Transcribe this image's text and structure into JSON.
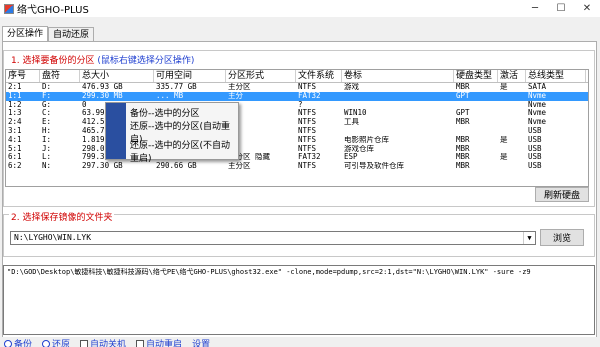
{
  "window": {
    "title": "络弋GHO-PLUS",
    "min": "─",
    "max": "☐",
    "close": "✕"
  },
  "tabs": [
    {
      "label": "分区操作",
      "active": true
    },
    {
      "label": "自动还原",
      "active": false
    }
  ],
  "section1": {
    "prefix": "1.",
    "text": "选择要备份的分区",
    "hint": "(鼠标右键选择分区操作)"
  },
  "columns": [
    "序号",
    "盘符",
    "总大小",
    "可用空间",
    "分区形式",
    "文件系统",
    "卷标",
    "硬盘类型",
    "激活",
    "总线类型"
  ],
  "rows": [
    [
      "2:1",
      "D:",
      "476.93  GB",
      "335.77  GB",
      "主分区",
      "NTFS",
      "游戏",
      "MBR",
      "是",
      "SATA"
    ],
    [
      "1:1",
      "F:",
      "299.30  MB",
      "...  MB",
      "主分",
      "FAT32",
      "",
      "GPT",
      "",
      "Nvme"
    ],
    [
      "1:2",
      "G:",
      "0",
      "",
      "",
      "?",
      "",
      "",
      "",
      "Nvme"
    ],
    [
      "1:3",
      "C:",
      "63.99",
      "",
      "",
      "NTFS",
      "WIN10",
      "GPT",
      "",
      "Nvme"
    ],
    [
      "2:4",
      "E:",
      "412.5",
      "",
      "",
      "NTFS",
      "工具",
      "MBR",
      "",
      "Nvme"
    ],
    [
      "3:1",
      "H:",
      "465.7",
      "",
      "",
      "NTFS",
      "",
      "",
      "",
      "USB"
    ],
    [
      "4:1",
      "I:",
      "1.819",
      "",
      "",
      "NTFS",
      "电影照片仓库",
      "MBR",
      "是",
      "USB"
    ],
    [
      "5:1",
      "J:",
      "298.0",
      "",
      "",
      "NTFS",
      "游戏仓库",
      "MBR",
      "",
      "USB"
    ],
    [
      "6:1",
      "L:",
      "799.39  MB",
      "325.84  MB",
      "主分区 隐藏",
      "FAT32",
      "ESP",
      "MBR",
      "是",
      "USB"
    ],
    [
      "6:2",
      "N:",
      "297.30  GB",
      "290.66  GB",
      "主分区",
      "NTFS",
      "可引导及软件仓库",
      "MBR",
      "",
      "USB"
    ]
  ],
  "selected_row": 1,
  "refresh_label": "刷新硬盘",
  "section2": {
    "prefix": "2.",
    "text": "选择保存镜像的文件夹"
  },
  "path_value": "N:\\LYGHO\\WIN.LYK",
  "browse_label": "浏览",
  "command_line": "\"D:\\GOD\\Desktop\\敏捷科技\\敏捷科技源码\\络弋PE\\络弋GHO-PLUS\\ghost32.exe\" -clone,mode=pdump,src=2:1,dst=\"N:\\LYGHO\\WIN.LYK\" -sure -z9",
  "context_menu": [
    "备份--选中的分区",
    "还原--选中的分区(自动重启)",
    "还原--选中的分区(不自动重启)"
  ],
  "bottom": {
    "backup": "备份",
    "restore": "还原",
    "auto_shutdown": "自动关机",
    "auto_reboot": "自动重启",
    "other": "设置"
  },
  "colors": {
    "accent": "#d00000",
    "hint": "#1f3fd0",
    "selection": "#3399ff"
  }
}
